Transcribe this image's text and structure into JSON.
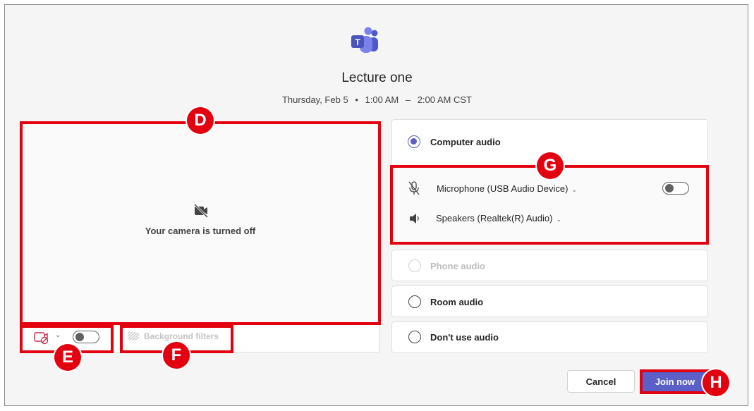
{
  "meeting": {
    "title": "Lecture one",
    "day": "Thursday, Feb 5",
    "dot": "•",
    "start": "1:00 AM",
    "dash": "–",
    "end": "2:00 AM CST"
  },
  "camera": {
    "status_text": "Your camera is turned off",
    "toggle_on": false,
    "background_filters_label": "Background filters"
  },
  "audio": {
    "computer_audio": "Computer audio",
    "microphone": "Microphone (USB Audio Device)",
    "microphone_on": false,
    "speakers": "Speakers (Realtek(R) Audio)",
    "phone_audio": "Phone audio",
    "room_audio": "Room audio",
    "no_audio": "Don't use audio",
    "selected": "Computer audio"
  },
  "actions": {
    "cancel": "Cancel",
    "join": "Join now"
  },
  "annotations": {
    "d": "D",
    "e": "E",
    "f": "F",
    "g": "G",
    "h": "H"
  },
  "colors": {
    "accent": "#5b5fc7",
    "annotation": "#e3000f"
  }
}
